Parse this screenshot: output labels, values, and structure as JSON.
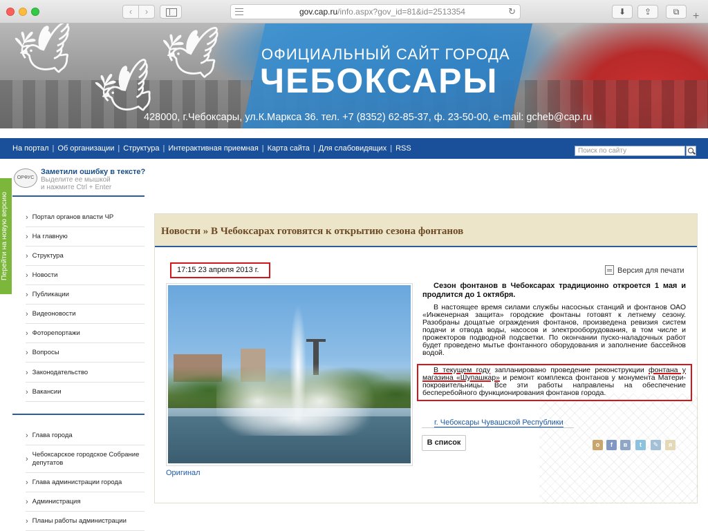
{
  "browser": {
    "url_host": "gov.cap.ru",
    "url_path": "/info.aspx?gov_id=81&id=2513354",
    "back_glyph": "‹",
    "forward_glyph": "›",
    "reload_glyph": "↻",
    "download_glyph": "⬇",
    "share_glyph": "⇪",
    "tabs_glyph": "⧉",
    "new_tab_glyph": "+"
  },
  "banner": {
    "title_line1": "ОФИЦИАЛЬНЫЙ САЙТ ГОРОДА",
    "title_line2": "ЧЕБОКСАРЫ",
    "address": "428000, г.Чебоксары, ул.К.Маркса 36. тел. +7 (8352) 62-85-37, ф. 23-50-00, e-mail: gcheb@cap.ru",
    "bird_glyph": "🕊"
  },
  "topnav": {
    "items": [
      "На портал",
      "Об организации",
      "Структура",
      "Интерактивная приемная",
      "Карта сайта",
      "Для слабовидящих",
      "RSS"
    ],
    "separator": "|",
    "search_placeholder": "Поиск по сайту"
  },
  "orphus": {
    "logo_text": "ОРФУС",
    "title": "Заметили ошибку в тексте?",
    "hint_line1": "Выделите ее мышкой",
    "hint_line2": "и нажмите Ctrl + Enter"
  },
  "new_version_tab": "Перейти на новую версию",
  "menu": {
    "group1": [
      "Портал органов власти ЧР",
      "На главную",
      "Структура",
      "Новости",
      "Публикации",
      "Видеоновости",
      "Фоторепортажи",
      "Вопросы",
      "Законодательство",
      "Вакансии"
    ],
    "group2": [
      "Глава города",
      "Чебоксарское городское Собрание депутатов",
      "Глава администрации города",
      "Администрация",
      "Планы работы администрации"
    ]
  },
  "article": {
    "breadcrumb": "Новости » В Чебоксарах готовятся к открытию сезона фонтанов",
    "datetime": "17:15 23 апреля 2013 г.",
    "print_label": "Версия для печати",
    "lead": "Сезон фонтанов в Чебоксарах традиционно откроется 1 мая и продлится до 1 октября.",
    "para1": "В настоящее время силами службы насосных станций и фонтанов ОАО «Инженерная защита» городские фонтаны готовят к летнему сезону. Разобраны дощатые ограждения фонтанов, произведена ревизия систем подачи и отвода воды, насосов и электрооборудования, в том числе и прожекторов подводной подсветки. По окончании пуско-наладочных работ будет проведено мытье фонтанного оборудования и заполнение бассейнов водой.",
    "para2_a": "В текущем году",
    "para2_b": " запланировано проведение реконструкции ",
    "para2_c": "фонтана у магазина «Шупашкар»",
    "para2_d": " и ремонт комплекса фонтанов у монумента Матери-покровительницы. Все эти работы направлены на обеспечение бесперебойного функционирования фонтанов города.",
    "original_link": "Оригинал",
    "location": "г. Чебоксары Чувашской Республики",
    "back_button": "В список",
    "share_icons": [
      "odnoklassniki-icon",
      "facebook-icon",
      "vkontakte-icon",
      "twitter-icon",
      "livejournal-icon",
      "yandex-icon"
    ],
    "share_glyphs": [
      "o",
      "f",
      "в",
      "t",
      "✎",
      "я"
    ]
  },
  "colors": {
    "nav_blue": "#1a4f9a",
    "title_bar": "#ece5c9",
    "title_text": "#6b4a24",
    "highlight_red": "#d4161b",
    "green_tab": "#7cb73b",
    "link_blue": "#1c5aa6"
  }
}
